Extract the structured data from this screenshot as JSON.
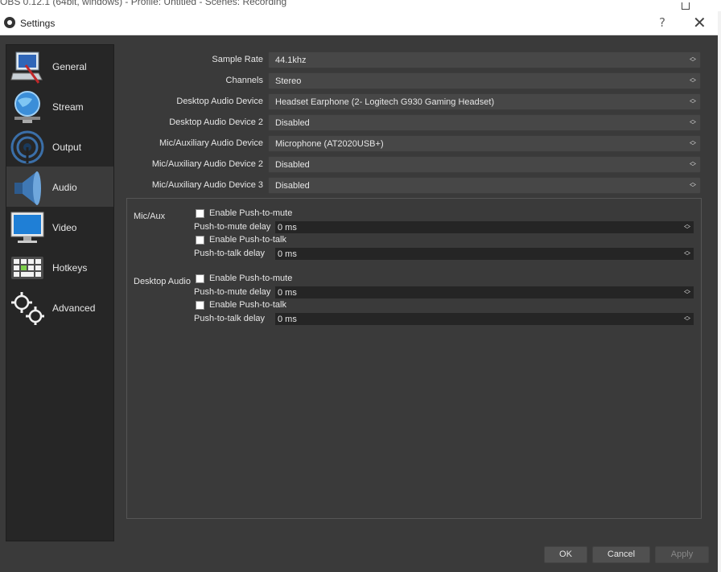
{
  "background_window": {
    "title": "OBS 0.12.1 (64bit, windows) - Profile: Untitled - Scenes: Recording"
  },
  "dialog": {
    "title": "Settings",
    "help": "?",
    "close": "✕"
  },
  "sidebar": {
    "items": [
      {
        "label": "General",
        "icon": "general-icon",
        "selected": false
      },
      {
        "label": "Stream",
        "icon": "stream-icon",
        "selected": false
      },
      {
        "label": "Output",
        "icon": "output-icon",
        "selected": false
      },
      {
        "label": "Audio",
        "icon": "audio-icon",
        "selected": true
      },
      {
        "label": "Video",
        "icon": "video-icon",
        "selected": false
      },
      {
        "label": "Hotkeys",
        "icon": "hotkeys-icon",
        "selected": false
      },
      {
        "label": "Advanced",
        "icon": "advanced-icon",
        "selected": false
      }
    ]
  },
  "audio": {
    "rows": [
      {
        "label": "Sample Rate",
        "value": "44.1khz"
      },
      {
        "label": "Channels",
        "value": "Stereo"
      },
      {
        "label": "Desktop Audio Device",
        "value": "Headset Earphone (2- Logitech G930 Gaming Headset)"
      },
      {
        "label": "Desktop Audio Device 2",
        "value": "Disabled"
      },
      {
        "label": "Mic/Auxiliary Audio Device",
        "value": "Microphone (AT2020USB+)"
      },
      {
        "label": "Mic/Auxiliary Audio Device 2",
        "value": "Disabled"
      },
      {
        "label": "Mic/Auxiliary Audio Device 3",
        "value": "Disabled"
      }
    ],
    "groups": [
      {
        "label": "Mic/Aux",
        "push_to_mute": "Enable Push-to-mute",
        "push_to_mute_delay_label": "Push-to-mute delay",
        "push_to_mute_delay": "0 ms",
        "push_to_talk": "Enable Push-to-talk",
        "push_to_talk_delay_label": "Push-to-talk delay",
        "push_to_talk_delay": "0 ms"
      },
      {
        "label": "Desktop Audio",
        "push_to_mute": "Enable Push-to-mute",
        "push_to_mute_delay_label": "Push-to-mute delay",
        "push_to_mute_delay": "0 ms",
        "push_to_talk": "Enable Push-to-talk",
        "push_to_talk_delay_label": "Push-to-talk delay",
        "push_to_talk_delay": "0 ms"
      }
    ]
  },
  "buttons": {
    "ok": "OK",
    "cancel": "Cancel",
    "apply": "Apply"
  },
  "colors": {
    "dialog_bg": "#3a3a3a",
    "sidebar_bg": "#262626",
    "selected_bg": "#3b3b3b",
    "combo_bg": "#474747",
    "spin_bg": "#252525"
  }
}
